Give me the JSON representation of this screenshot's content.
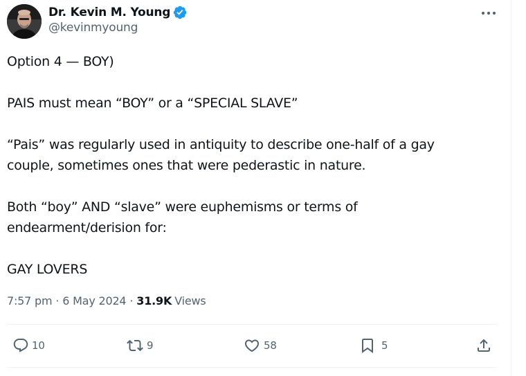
{
  "author": {
    "display_name": "Dr. Kevin M. Young",
    "handle": "@kevinmyoung",
    "verified": true,
    "verified_color": "#1d9bf0"
  },
  "tweet": {
    "paragraphs": [
      [
        "Option 4 — BOY)"
      ],
      [
        "PAIS must mean “BOY” or a “SPECIAL SLAVE”"
      ],
      [
        "“Pais” was regularly used in antiquity to describe one-half of a gay",
        "couple, sometimes ones that were pederastic in nature."
      ],
      [
        "Both “boy” AND “slave” were euphemisms or terms of",
        "endearment/derision for:"
      ],
      [
        "GAY LOVERS"
      ]
    ]
  },
  "meta": {
    "time": "7:57 pm",
    "separator": "·",
    "date": "6 May 2024",
    "views_count": "31.9K",
    "views_label": "Views"
  },
  "actions": {
    "reply": {
      "icon": "reply-icon",
      "count": "10"
    },
    "repost": {
      "icon": "repost-icon",
      "count": "9"
    },
    "like": {
      "icon": "heart-icon",
      "count": "58"
    },
    "bookmark": {
      "icon": "bookmark-icon",
      "count": "5"
    },
    "share": {
      "icon": "share-icon"
    }
  },
  "colors": {
    "text_primary": "#0f1419",
    "text_secondary": "#536471",
    "border": "#eff3f4"
  }
}
